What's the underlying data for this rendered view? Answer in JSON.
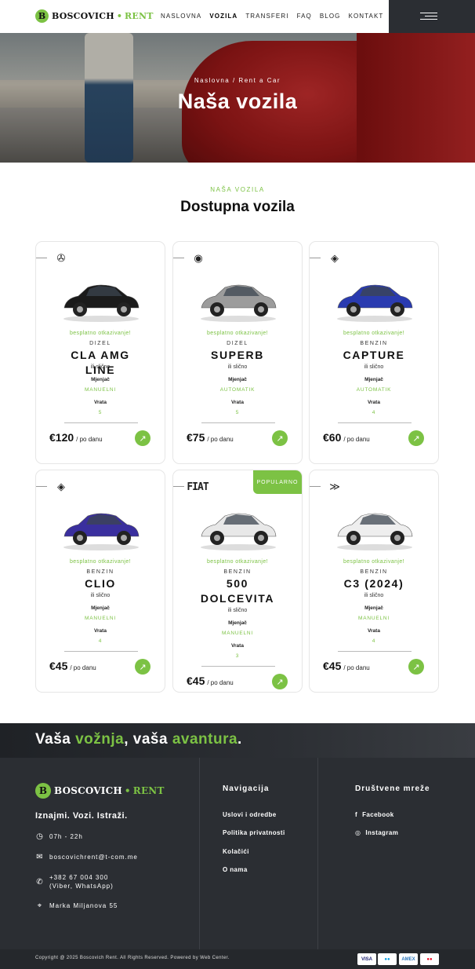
{
  "brand": {
    "badge": "B",
    "name": "BOSCOVICH",
    "separator": "•",
    "suffix": "RENT"
  },
  "nav": {
    "items": [
      {
        "label": "NASLOVNA",
        "active": false
      },
      {
        "label": "VOZILA",
        "active": true
      },
      {
        "label": "TRANSFERI",
        "active": false
      },
      {
        "label": "FAQ",
        "active": false
      },
      {
        "label": "BLOG",
        "active": false
      },
      {
        "label": "KONTAKT",
        "active": false
      }
    ],
    "menu_icon": "hamburger-icon"
  },
  "hero": {
    "breadcrumb": "Naslovna / Rent a Car",
    "title": "Naša vozila"
  },
  "section": {
    "eyebrow": "NAŠA VOZILA",
    "title": "Dostupna vozila"
  },
  "cards": [
    {
      "brand_icon": "mercedes-logo-icon",
      "brand_glyph": "✇",
      "car_color": "#1b1b1b",
      "badge": "",
      "cancel": "besplatno otkazivanje!",
      "fuel": "DIZEL",
      "model": "CLA AMG LINE",
      "similar": "ili slično",
      "trans_label": "Mjenjač",
      "trans_value": "MANUELNI",
      "doors_label": "Vrata",
      "doors_value": "5",
      "price": "€120",
      "per": "/ po danu"
    },
    {
      "brand_icon": "skoda-logo-icon",
      "brand_glyph": "◉",
      "car_color": "#9c9c9c",
      "badge": "",
      "cancel": "besplatno otkazivanje!",
      "fuel": "DIZEL",
      "model": "SUPERB",
      "similar": "ili slično",
      "trans_label": "Mjenjač",
      "trans_value": "AUTOMATIK",
      "doors_label": "Vrata",
      "doors_value": "5",
      "price": "€75",
      "per": "/ po danu"
    },
    {
      "brand_icon": "renault-logo-icon",
      "brand_glyph": "◈",
      "car_color": "#2a3bb0",
      "badge": "",
      "cancel": "besplatno otkazivanje!",
      "fuel": "BENZIN",
      "model": "CAPTURE",
      "similar": "ili slično",
      "trans_label": "Mjenjač",
      "trans_value": "AUTOMATIK",
      "doors_label": "Vrata",
      "doors_value": "4",
      "price": "€60",
      "per": "/ po danu"
    },
    {
      "brand_icon": "renault-logo-icon",
      "brand_glyph": "◈",
      "car_color": "#3a2f9e",
      "badge": "",
      "cancel": "besplatno otkazivanje!",
      "fuel": "BENZIN",
      "model": "CLIO",
      "similar": "ili slično",
      "trans_label": "Mjenjač",
      "trans_value": "MANUELNI",
      "doors_label": "Vrata",
      "doors_value": "4",
      "price": "€45",
      "per": "/ po danu"
    },
    {
      "brand_icon": "fiat-logo-icon",
      "brand_glyph": "FIAT",
      "car_color": "#e8e8e8",
      "badge": "POPULARNO",
      "cancel": "besplatno otkazivanje!",
      "fuel": "BENZIN",
      "model": "500 DOLCEVITA",
      "similar": "ili slično",
      "trans_label": "Mjenjač",
      "trans_value": "MANUELNI",
      "doors_label": "Vrata",
      "doors_value": "3",
      "price": "€45",
      "per": "/ po danu"
    },
    {
      "brand_icon": "citroen-logo-icon",
      "brand_glyph": "≫",
      "car_color": "#eeeeee",
      "badge": "",
      "cancel": "besplatno otkazivanje!",
      "fuel": "BENZIN",
      "model": "C3 (2024)",
      "similar": "ili slično",
      "trans_label": "Mjenjač",
      "trans_value": "MANUELNI",
      "doors_label": "Vrata",
      "doors_value": "4",
      "price": "€45",
      "per": "/ po danu"
    }
  ],
  "footer": {
    "slogan_a": "Vaša ",
    "slogan_b": "vožnja",
    "slogan_c": ", vaša ",
    "slogan_d": "avantura",
    "slogan_e": ".",
    "tagline": "Iznajmi. Vozi. Istraži.",
    "hours": "07h - 22h",
    "email": "boscovichrent@t-com.me",
    "phone": "+382 67 004 300",
    "phone_note": "(Viber, WhatsApp)",
    "address": "Marka Miljanova 55",
    "nav_title": "Navigacija",
    "nav_links": [
      "Uslovi i odredbe",
      "Politika privatnosti",
      "Kolačići",
      "O nama"
    ],
    "social_title": "Društvene mreže",
    "social_links": [
      {
        "icon": "facebook-icon",
        "glyph": "f",
        "label": "Facebook"
      },
      {
        "icon": "instagram-icon",
        "glyph": "◎",
        "label": "Instagram"
      }
    ],
    "copyright": "Copyright @ 2025 Boscovich Rent. All Rights Reserved. Powered by Web Center.",
    "payments": [
      {
        "name": "visa-icon",
        "label": "VISA",
        "color": "#1a1f71"
      },
      {
        "name": "maestro-icon",
        "label": "●●",
        "color": "#0099df"
      },
      {
        "name": "amex-icon",
        "label": "AMEX",
        "color": "#2e77bb"
      },
      {
        "name": "mastercard-icon",
        "label": "●●",
        "color": "#eb001b"
      }
    ]
  },
  "colors": {
    "accent": "#7cc244",
    "dark": "#2b2e33"
  }
}
